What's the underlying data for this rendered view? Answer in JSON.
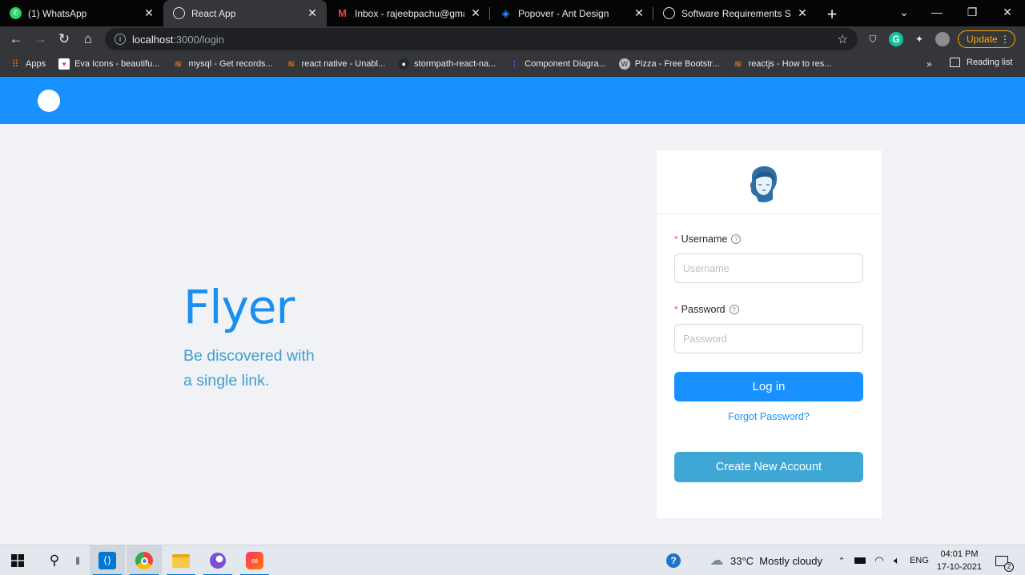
{
  "browser": {
    "tabs": [
      {
        "title": "(1) WhatsApp",
        "icon": "whatsapp-icon",
        "color": "#25d366",
        "active": false
      },
      {
        "title": "React App",
        "icon": "globe-icon",
        "color": "#9aa0a6",
        "active": true
      },
      {
        "title": "Inbox - rajeebpachu@gmail.c",
        "icon": "gmail-icon",
        "color": "#ea4335",
        "active": false
      },
      {
        "title": "Popover - Ant Design",
        "icon": "ant-design-icon",
        "color": "#1890ff",
        "active": false
      },
      {
        "title": "Software Requirements Spec",
        "icon": "globe-icon",
        "color": "#9aa0a6",
        "active": false
      }
    ],
    "url_host": "localhost",
    "url_path": ":3000/login",
    "update_label": "Update",
    "bookmarks": [
      {
        "label": "Apps",
        "icon": "apps-grid-icon",
        "color": "#e8711a"
      },
      {
        "label": "Eva Icons - beautifu...",
        "icon": "eva-heart-icon",
        "color": "#ff3d71"
      },
      {
        "label": "mysql - Get records...",
        "icon": "stackoverflow-icon",
        "color": "#f48024"
      },
      {
        "label": "react native - Unabl...",
        "icon": "stackoverflow-icon",
        "color": "#f48024"
      },
      {
        "label": "stormpath-react-na...",
        "icon": "github-icon",
        "color": "#24292e"
      },
      {
        "label": "Component Diagra...",
        "icon": "figma-icon",
        "color": "#a259ff"
      },
      {
        "label": "Pizza - Free Bootstr...",
        "icon": "wordpress-icon",
        "color": "#bbbbbb"
      },
      {
        "label": "reactjs - How to res...",
        "icon": "stackoverflow-icon",
        "color": "#f48024"
      }
    ],
    "more_bookmarks": "»",
    "reading_list": "Reading list"
  },
  "page": {
    "brand_title": "Flyer",
    "tagline_line1": "Be discovered with",
    "tagline_line2": "a single link.",
    "form": {
      "username_label": "Username",
      "username_placeholder": "Username",
      "username_value": "",
      "password_label": "Password",
      "password_placeholder": "Password",
      "password_value": "",
      "login_label": "Log in",
      "forgot_label": "Forgot Password?",
      "create_label": "Create New Account"
    },
    "colors": {
      "header": "#1890ff",
      "brand": "#1a8ff0",
      "primary": "#1890ff",
      "secondary": "#3fa7d6"
    }
  },
  "taskbar": {
    "weather": "33°C  Mostly cloudy",
    "language": "ENG",
    "time": "04:01 PM",
    "date": "17-10-2021",
    "notifications": "2"
  }
}
